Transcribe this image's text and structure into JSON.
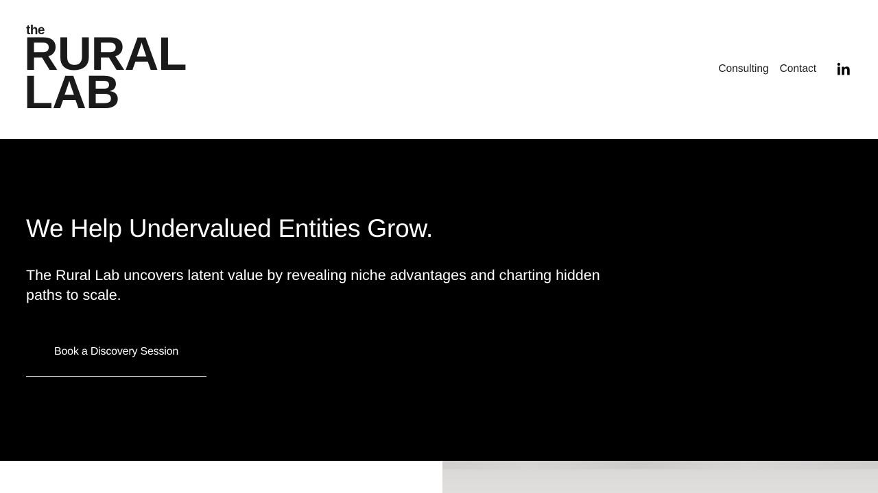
{
  "header": {
    "logo": {
      "small": "the",
      "line1": "RURAL",
      "line2": "LAB"
    },
    "nav": [
      {
        "label": "Consulting"
      },
      {
        "label": "Contact"
      }
    ],
    "social_icon": "linkedin-icon"
  },
  "hero": {
    "title": "We Help Undervalued Entities Grow.",
    "subtitle": "The Rural Lab uncovers latent value by revealing niche advantages and charting hidden paths to scale.",
    "cta_label": "Book a Discovery Session"
  },
  "colors": {
    "hero_background": "#000000",
    "header_background": "#ffffff",
    "logo_text": "#1a1a1a",
    "image_tone": "#d8d6d5"
  }
}
